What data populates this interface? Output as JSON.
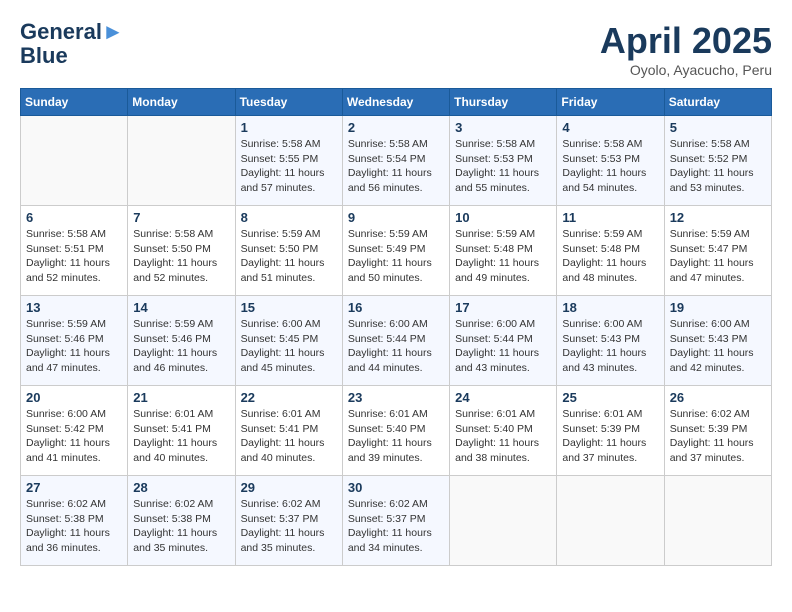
{
  "header": {
    "logo_line1": "General",
    "logo_line2": "Blue",
    "title": "April 2025",
    "subtitle": "Oyolo, Ayacucho, Peru"
  },
  "weekdays": [
    "Sunday",
    "Monday",
    "Tuesday",
    "Wednesday",
    "Thursday",
    "Friday",
    "Saturday"
  ],
  "weeks": [
    [
      {
        "day": "",
        "info": ""
      },
      {
        "day": "",
        "info": ""
      },
      {
        "day": "1",
        "info": "Sunrise: 5:58 AM\nSunset: 5:55 PM\nDaylight: 11 hours and 57 minutes."
      },
      {
        "day": "2",
        "info": "Sunrise: 5:58 AM\nSunset: 5:54 PM\nDaylight: 11 hours and 56 minutes."
      },
      {
        "day": "3",
        "info": "Sunrise: 5:58 AM\nSunset: 5:53 PM\nDaylight: 11 hours and 55 minutes."
      },
      {
        "day": "4",
        "info": "Sunrise: 5:58 AM\nSunset: 5:53 PM\nDaylight: 11 hours and 54 minutes."
      },
      {
        "day": "5",
        "info": "Sunrise: 5:58 AM\nSunset: 5:52 PM\nDaylight: 11 hours and 53 minutes."
      }
    ],
    [
      {
        "day": "6",
        "info": "Sunrise: 5:58 AM\nSunset: 5:51 PM\nDaylight: 11 hours and 52 minutes."
      },
      {
        "day": "7",
        "info": "Sunrise: 5:58 AM\nSunset: 5:50 PM\nDaylight: 11 hours and 52 minutes."
      },
      {
        "day": "8",
        "info": "Sunrise: 5:59 AM\nSunset: 5:50 PM\nDaylight: 11 hours and 51 minutes."
      },
      {
        "day": "9",
        "info": "Sunrise: 5:59 AM\nSunset: 5:49 PM\nDaylight: 11 hours and 50 minutes."
      },
      {
        "day": "10",
        "info": "Sunrise: 5:59 AM\nSunset: 5:48 PM\nDaylight: 11 hours and 49 minutes."
      },
      {
        "day": "11",
        "info": "Sunrise: 5:59 AM\nSunset: 5:48 PM\nDaylight: 11 hours and 48 minutes."
      },
      {
        "day": "12",
        "info": "Sunrise: 5:59 AM\nSunset: 5:47 PM\nDaylight: 11 hours and 47 minutes."
      }
    ],
    [
      {
        "day": "13",
        "info": "Sunrise: 5:59 AM\nSunset: 5:46 PM\nDaylight: 11 hours and 47 minutes."
      },
      {
        "day": "14",
        "info": "Sunrise: 5:59 AM\nSunset: 5:46 PM\nDaylight: 11 hours and 46 minutes."
      },
      {
        "day": "15",
        "info": "Sunrise: 6:00 AM\nSunset: 5:45 PM\nDaylight: 11 hours and 45 minutes."
      },
      {
        "day": "16",
        "info": "Sunrise: 6:00 AM\nSunset: 5:44 PM\nDaylight: 11 hours and 44 minutes."
      },
      {
        "day": "17",
        "info": "Sunrise: 6:00 AM\nSunset: 5:44 PM\nDaylight: 11 hours and 43 minutes."
      },
      {
        "day": "18",
        "info": "Sunrise: 6:00 AM\nSunset: 5:43 PM\nDaylight: 11 hours and 43 minutes."
      },
      {
        "day": "19",
        "info": "Sunrise: 6:00 AM\nSunset: 5:43 PM\nDaylight: 11 hours and 42 minutes."
      }
    ],
    [
      {
        "day": "20",
        "info": "Sunrise: 6:00 AM\nSunset: 5:42 PM\nDaylight: 11 hours and 41 minutes."
      },
      {
        "day": "21",
        "info": "Sunrise: 6:01 AM\nSunset: 5:41 PM\nDaylight: 11 hours and 40 minutes."
      },
      {
        "day": "22",
        "info": "Sunrise: 6:01 AM\nSunset: 5:41 PM\nDaylight: 11 hours and 40 minutes."
      },
      {
        "day": "23",
        "info": "Sunrise: 6:01 AM\nSunset: 5:40 PM\nDaylight: 11 hours and 39 minutes."
      },
      {
        "day": "24",
        "info": "Sunrise: 6:01 AM\nSunset: 5:40 PM\nDaylight: 11 hours and 38 minutes."
      },
      {
        "day": "25",
        "info": "Sunrise: 6:01 AM\nSunset: 5:39 PM\nDaylight: 11 hours and 37 minutes."
      },
      {
        "day": "26",
        "info": "Sunrise: 6:02 AM\nSunset: 5:39 PM\nDaylight: 11 hours and 37 minutes."
      }
    ],
    [
      {
        "day": "27",
        "info": "Sunrise: 6:02 AM\nSunset: 5:38 PM\nDaylight: 11 hours and 36 minutes."
      },
      {
        "day": "28",
        "info": "Sunrise: 6:02 AM\nSunset: 5:38 PM\nDaylight: 11 hours and 35 minutes."
      },
      {
        "day": "29",
        "info": "Sunrise: 6:02 AM\nSunset: 5:37 PM\nDaylight: 11 hours and 35 minutes."
      },
      {
        "day": "30",
        "info": "Sunrise: 6:02 AM\nSunset: 5:37 PM\nDaylight: 11 hours and 34 minutes."
      },
      {
        "day": "",
        "info": ""
      },
      {
        "day": "",
        "info": ""
      },
      {
        "day": "",
        "info": ""
      }
    ]
  ]
}
